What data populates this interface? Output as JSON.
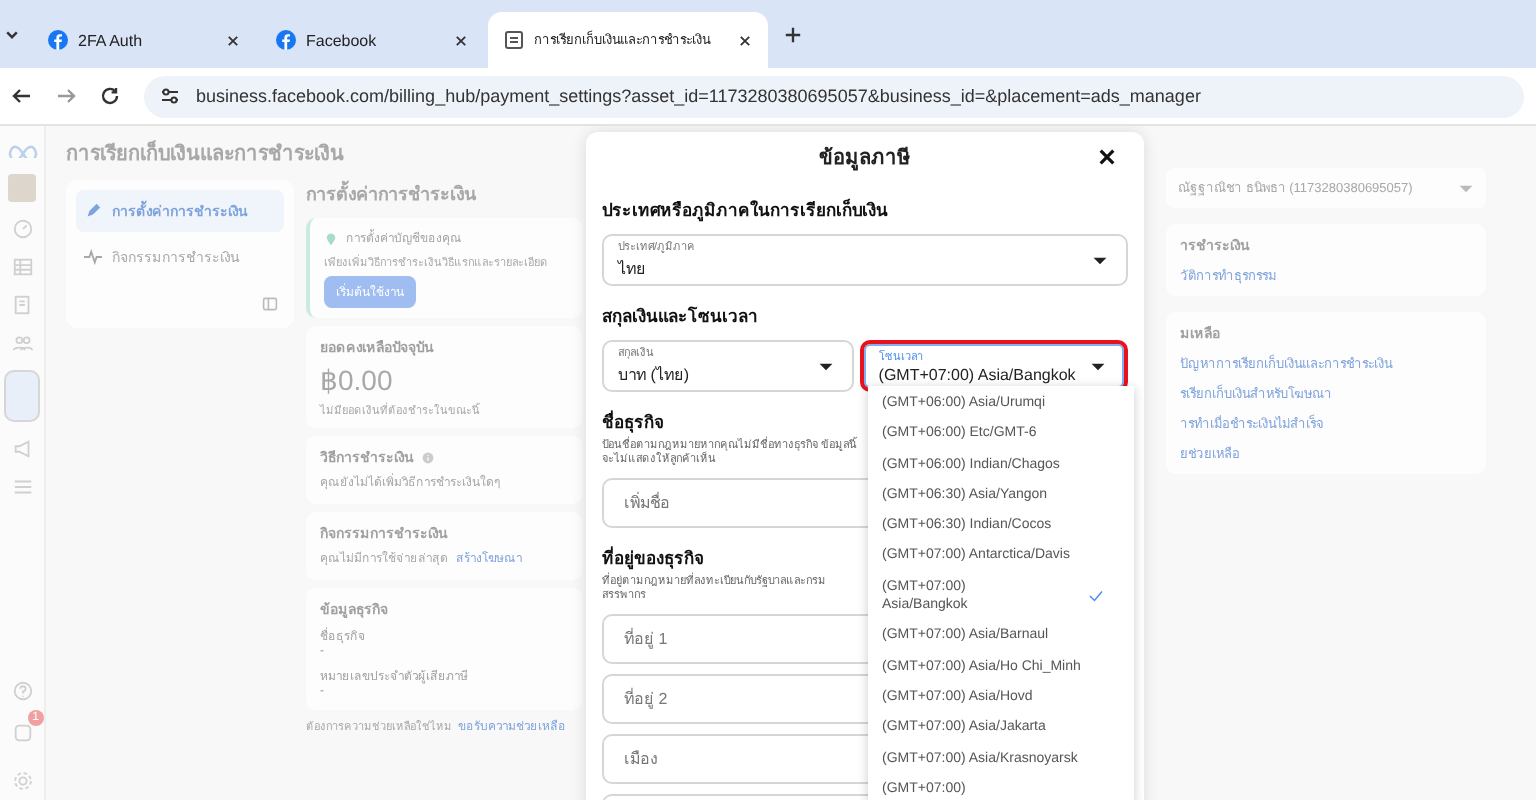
{
  "browser": {
    "tabs": [
      {
        "title": "2FA Auth",
        "selected": false
      },
      {
        "title": "Facebook",
        "selected": false
      },
      {
        "title": "การเรียกเก็บเงินและการชำระเงิน",
        "selected": true
      }
    ],
    "url": "business.facebook.com/billing_hub/payment_settings?asset_id=1173280380695057&business_id=&placement=ads_manager"
  },
  "rail": {
    "items": [
      {
        "kind": "gauge",
        "selected": false
      },
      {
        "kind": "table",
        "selected": false
      },
      {
        "kind": "doc",
        "selected": false
      },
      {
        "kind": "people",
        "selected": false
      },
      {
        "kind": "billing",
        "selected": true
      },
      {
        "kind": "megaphone",
        "selected": false
      },
      {
        "kind": "menu",
        "selected": false
      }
    ],
    "notification_badge": "1"
  },
  "page": {
    "title": "การเรียกเก็บเงินและการชำระเงิน",
    "nav": [
      {
        "label": "การตั้งค่าการชำระเงิน",
        "selected": true
      },
      {
        "label": "กิจกรรมการชำระเงิน",
        "selected": false
      }
    ],
    "heading": "การตั้งค่าการชำระเงิน",
    "notice": {
      "title": "การตั้งค่าบัญชีของคุณ",
      "text": "เพียงเพิ่มวิธีการชำระเงินวิธีแรกและรายละเอียด",
      "button": "เริ่มต้นใช้งาน"
    },
    "balance": {
      "title": "ยอดคงเหลือปัจจุบัน",
      "amount": "฿0.00",
      "note": "ไม่มียอดเงินที่ต้องชำระในขณะนี้"
    },
    "methods": {
      "title": "วิธีการชำระเงิน",
      "text": "คุณยังไม่ได้เพิ่มวิธีการชำระเงินใดๆ"
    },
    "activity": {
      "title": "กิจกรรมการชำระเงิน",
      "text": "คุณไม่มีการใช้จ่ายล่าสุด",
      "link": "สร้างโฆษณา"
    },
    "business": {
      "title": "ข้อมูลธุรกิจ",
      "fields": [
        {
          "label": "ชื่อธุรกิจ",
          "value": "-"
        },
        {
          "label": "หมายเลขประจำตัวผู้เสียภาษี",
          "value": "-"
        }
      ]
    },
    "help": {
      "text": "ต้องการความช่วยเหลือใช่ไหม",
      "link": "ขอรับความช่วยเหลือ"
    },
    "account": "ณัฐฐาณิชา ธนิพธา (1173280380695057)",
    "right_cards": [
      {
        "title": "ารชำระเงิน",
        "links": [
          "วัติการทำธุรกรรม"
        ]
      },
      {
        "title": "มเหลือ",
        "links": [
          "ปัญหาการเรียกเก็บเงินและการชำระเงิน",
          "รเรียกเก็บเงินสำหรับโฆษณา",
          "ารทำเมื่อชำระเงินไม่สำเร็จ",
          "ยช่วยเหลือ"
        ]
      }
    ]
  },
  "modal": {
    "title": "ข้อมูลภาษี",
    "country": {
      "heading": "ประเทศหรือภูมิภาคในการเรียกเก็บเงิน",
      "label": "ประเทศ/ภูมิภาค",
      "value": "ไทย"
    },
    "currency_heading": "สกุลเงินและโซนเวลา",
    "currency": {
      "label": "สกุลเงิน",
      "value": "บาท (ไทย)"
    },
    "timezone": {
      "label": "โซนเวลา",
      "value": "(GMT+07:00) Asia/Bangkok",
      "expanded": true
    },
    "business_name": {
      "heading": "ชื่อธุรกิจ",
      "help": "ป้อนชื่อตามกฎหมายหากคุณไม่มีชื่อทางธุรกิจ ข้อมูลนี้จะไม่แสดงให้ลูกค้าเห็น",
      "placeholder": "เพิ่มชื่อ"
    },
    "address": {
      "heading": "ที่อยู่ของธุรกิจ",
      "help": "ที่อยู่ตามกฎหมายที่ลงทะเบียนกับรัฐบาลและกรมสรรพากร",
      "placeholders": [
        "ที่อยู่ 1",
        "ที่อยู่ 2",
        "เมือง"
      ]
    },
    "options": [
      {
        "label": "(GMT+06:00) Asia/Urumqi",
        "selected": false
      },
      {
        "label": "(GMT+06:00) Etc/GMT-6",
        "selected": false
      },
      {
        "label": "(GMT+06:00) Indian/Chagos",
        "selected": false
      },
      {
        "label": "(GMT+06:30) Asia/Yangon",
        "selected": false
      },
      {
        "label": "(GMT+06:30) Indian/Cocos",
        "selected": false
      },
      {
        "label": "(GMT+07:00) Antarctica/Davis",
        "selected": false
      },
      {
        "label": "(GMT+07:00) Asia/Bangkok",
        "selected": true
      },
      {
        "label": "(GMT+07:00) Asia/Barnaul",
        "selected": false
      },
      {
        "label": "(GMT+07:00) Asia/Ho Chi_Minh",
        "selected": false
      },
      {
        "label": "(GMT+07:00) Asia/Hovd",
        "selected": false
      },
      {
        "label": "(GMT+07:00) Asia/Jakarta",
        "selected": false
      },
      {
        "label": "(GMT+07:00) Asia/Krasnoyarsk",
        "selected": false
      },
      {
        "label": "(GMT+07:00)",
        "selected": false
      }
    ]
  }
}
